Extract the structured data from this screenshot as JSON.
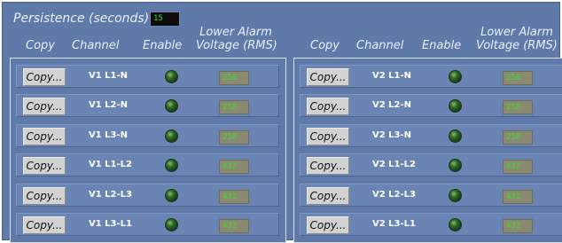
{
  "persistence": {
    "label": "Persistence (seconds)",
    "value": "15"
  },
  "headers": {
    "copy": "Copy",
    "channel": "Channel",
    "enable": "Enable",
    "lower_alarm_line1": "Lower Alarm",
    "lower_alarm_line2": "Voltage (RMS)"
  },
  "left": {
    "rows": [
      {
        "copy": "Copy...",
        "channel": "V1 L1-N",
        "voltage": "250"
      },
      {
        "copy": "Copy...",
        "channel": "V1 L2-N",
        "voltage": "250"
      },
      {
        "copy": "Copy...",
        "channel": "V1 L3-N",
        "voltage": "250"
      },
      {
        "copy": "Copy...",
        "channel": "V1 L1-L2",
        "voltage": "432"
      },
      {
        "copy": "Copy...",
        "channel": "V1 L2-L3",
        "voltage": "432"
      },
      {
        "copy": "Copy...",
        "channel": "V1 L3-L1",
        "voltage": "432"
      }
    ]
  },
  "right": {
    "rows": [
      {
        "copy": "Copy...",
        "channel": "V2 L1-N",
        "voltage": "250"
      },
      {
        "copy": "Copy...",
        "channel": "V2 L2-N",
        "voltage": "250"
      },
      {
        "copy": "Copy...",
        "channel": "V2 L3-N",
        "voltage": "250"
      },
      {
        "copy": "Copy...",
        "channel": "V2 L1-L2",
        "voltage": "432"
      },
      {
        "copy": "Copy...",
        "channel": "V2 L2-L3",
        "voltage": "432"
      },
      {
        "copy": "Copy...",
        "channel": "V2 L3-L1",
        "voltage": "432"
      }
    ]
  },
  "colors": {
    "panel_bg": "#5f7aa8",
    "value_text": "#38df2a",
    "led": "#2f6b2a"
  },
  "icons": {
    "enable": "led-indicator-icon"
  }
}
